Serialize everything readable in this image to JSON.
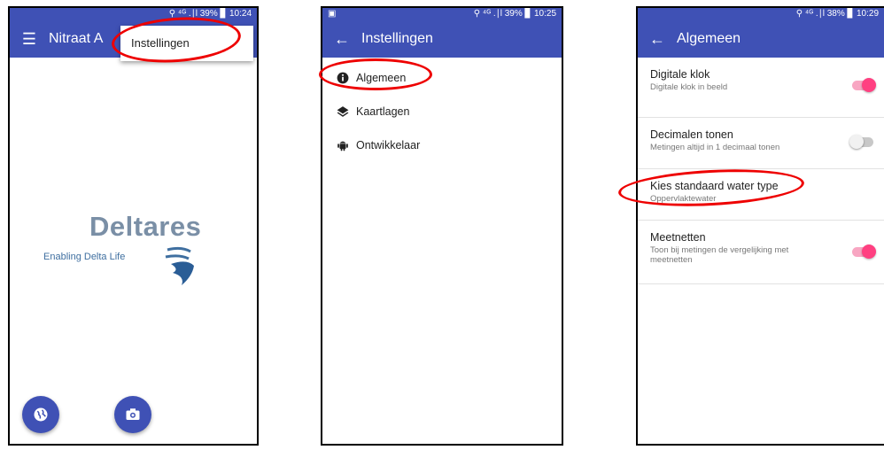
{
  "screen1": {
    "status": "⚲ ⁴ᴳ .∣l 39% ▊ 10:24",
    "title": "Nitraat A",
    "menu_item": "Instellingen",
    "logo_word": "Deltares",
    "logo_tagline": "Enabling Delta Life"
  },
  "screen2": {
    "status": "⚲ ⁴ᴳ .∣l 39% ▊ 10:25",
    "title": "Instellingen",
    "items": [
      {
        "label": "Algemeen",
        "icon": "info-icon"
      },
      {
        "label": "Kaartlagen",
        "icon": "layers-icon"
      },
      {
        "label": "Ontwikkelaar",
        "icon": "android-icon"
      }
    ]
  },
  "screen3": {
    "status": "⚲ ⁴ᴳ .∣l 38% ▊ 10:29",
    "title": "Algemeen",
    "prefs": [
      {
        "title": "Digitale klok",
        "summary": "Digitale klok in beeld",
        "toggle": "on"
      },
      {
        "title": "Decimalen tonen",
        "summary": "Metingen altijd in 1 decimaal tonen",
        "toggle": "off"
      },
      {
        "title": "Kies standaard water type",
        "summary": "Oppervlaktewater"
      },
      {
        "title": "Meetnetten",
        "summary": "Toon bij metingen de vergelijking met meetnetten",
        "toggle": "on"
      }
    ]
  },
  "colors": {
    "primary": "#3f51b5",
    "accent": "#ff4081",
    "highlight": "#e00000"
  }
}
